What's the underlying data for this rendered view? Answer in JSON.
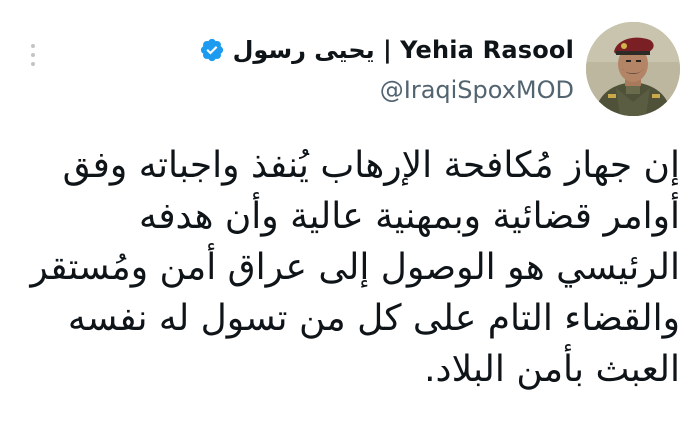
{
  "tweet": {
    "author": {
      "display_name": "يحيى رسول | Yehia Rasool",
      "handle": "@IraqiSpoxMOD",
      "verified_icon": "verified-badge-icon",
      "avatar": "profile-photo"
    },
    "more_icon": "more-options-icon",
    "text_lines": [
      "إن جهاز مُكافحة الإرهاب يُنفذ واجباته وفق",
      "أوامر قضائية وبمهنية عالية وأن هدفه",
      "الرئيسي هو الوصول إلى عراق أمن ومُستقر",
      "والقضاء التام على كل من تسول له نفسه",
      "العبث بأمن البلاد."
    ]
  },
  "colors": {
    "text": "#0f1419",
    "secondary_text": "#536471",
    "verified_blue": "#1d9bf0",
    "background": "#ffffff"
  }
}
